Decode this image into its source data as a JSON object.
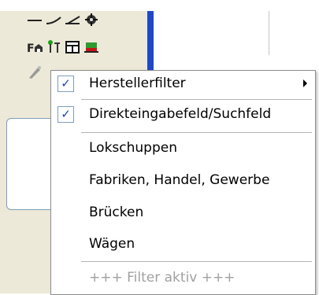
{
  "top_text": {
    "left": "",
    "right": ""
  },
  "menu": {
    "items": [
      {
        "label": "Herstellerfilter",
        "checked": true,
        "submenu": true
      },
      {
        "label": "Direkteingabefeld/Suchfeld",
        "checked": true,
        "submenu": false
      },
      {
        "label": "Lokschuppen",
        "checked": false
      },
      {
        "label": "Fabriken, Handel, Gewerbe",
        "checked": false
      },
      {
        "label": "Brücken",
        "checked": false
      },
      {
        "label": "Wägen",
        "checked": false
      },
      {
        "label": "+++ Filter aktiv +++",
        "checked": false,
        "disabled": true
      }
    ],
    "check_glyph": "✓"
  },
  "toolbar_icons": [
    "straight-track-icon",
    "curved-track-icon",
    "switch-track-icon",
    "turntable-icon",
    "fa-building-icon",
    "signal-icon",
    "window-icon",
    "platform-icon",
    "wand-icon"
  ],
  "colors": {
    "panel": "#ece9d8",
    "blue_bar": "#1f48c8",
    "check": "#1c43b0",
    "disabled_text": "#a0a0a0"
  }
}
